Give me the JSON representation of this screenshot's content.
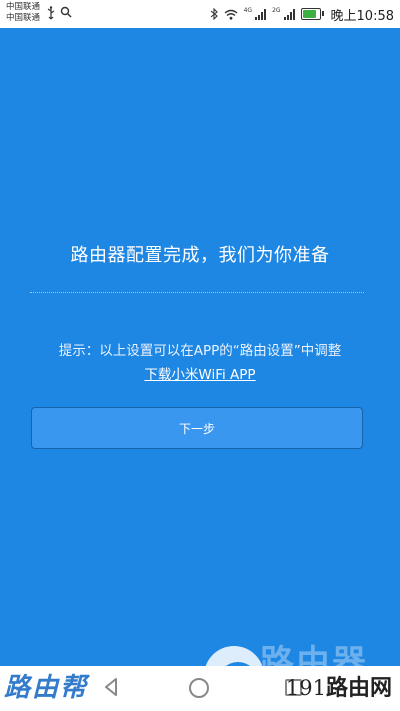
{
  "status_bar": {
    "carrier_1": "中国联通",
    "carrier_2": "中国联通",
    "network_1": "4G",
    "network_2": "2G",
    "battery_level": 0.85,
    "time": "晚上10:58"
  },
  "main": {
    "title": "路由器配置完成，我们为你准备",
    "hint": "提示：以上设置可以在APP的“路由设置”中调整",
    "app_link": "下载小米WiFi APP",
    "next_button": "下一步"
  },
  "watermark": {
    "left_text": "路由帮",
    "right_number": "191",
    "right_text": "路由网",
    "ghost_text": "路由器"
  },
  "colors": {
    "background": "#1e86e3",
    "button": "#3a97f0",
    "button_border": "#1763ad"
  }
}
